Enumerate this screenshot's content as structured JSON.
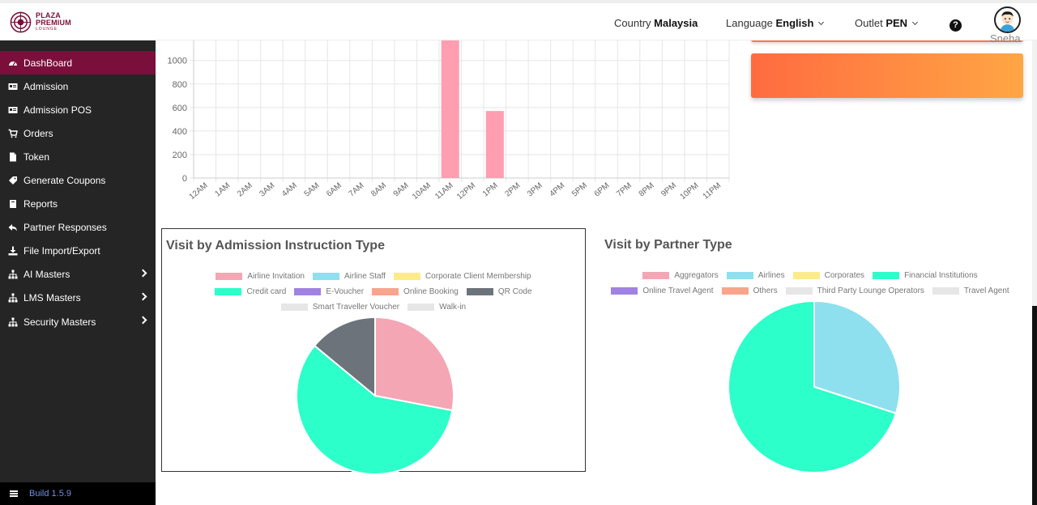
{
  "brand": {
    "name_line1": "PLAZA",
    "name_line2": "PREMIUM",
    "name_line3": "LOUNGE",
    "color": "#7b0f3c"
  },
  "header": {
    "country_label": "Country",
    "country_value": "Malaysia",
    "language_label": "Language",
    "language_value": "English",
    "outlet_label": "Outlet",
    "outlet_value": "PEN",
    "user_name": "Sneha"
  },
  "sidebar": {
    "items": [
      {
        "label": "DashBoard",
        "icon": "dashboard-icon",
        "active": true
      },
      {
        "label": "Admission",
        "icon": "id-card-icon"
      },
      {
        "label": "Admission POS",
        "icon": "pos-icon"
      },
      {
        "label": "Orders",
        "icon": "cart-icon"
      },
      {
        "label": "Token",
        "icon": "file-icon"
      },
      {
        "label": "Generate Coupons",
        "icon": "tag-icon"
      },
      {
        "label": "Reports",
        "icon": "book-icon"
      },
      {
        "label": "Partner Responses",
        "icon": "reply-icon"
      },
      {
        "label": "File Import/Export",
        "icon": "download-icon"
      },
      {
        "label": "AI Masters",
        "icon": "sitemap-icon",
        "submenu": true
      },
      {
        "label": "LMS Masters",
        "icon": "sitemap-icon",
        "submenu": true
      },
      {
        "label": "Security Masters",
        "icon": "sitemap-icon",
        "submenu": true
      }
    ],
    "build": "Build 1.5.9"
  },
  "chart_data": [
    {
      "type": "bar",
      "categories": [
        "12AM",
        "1AM",
        "2AM",
        "3AM",
        "4AM",
        "5AM",
        "6AM",
        "7AM",
        "8AM",
        "9AM",
        "10AM",
        "11AM",
        "12PM",
        "1PM",
        "2PM",
        "3PM",
        "4PM",
        "5PM",
        "6PM",
        "7PM",
        "8PM",
        "9PM",
        "10PM",
        "11PM"
      ],
      "values": [
        0,
        0,
        0,
        0,
        0,
        0,
        0,
        0,
        0,
        0,
        0,
        1170,
        0,
        570,
        0,
        0,
        0,
        0,
        0,
        0,
        0,
        0,
        0,
        0
      ],
      "yticks": [
        0,
        200,
        400,
        600,
        800,
        1000
      ],
      "ylim": [
        0,
        1170
      ],
      "color": "#ff9db1",
      "grid": true
    },
    {
      "type": "pie",
      "title": "Visit by Admission Instruction Type",
      "legend": [
        {
          "name": "Airline Invitation",
          "color": "#f4a6b4"
        },
        {
          "name": "Airline Staff",
          "color": "#8ee0ef"
        },
        {
          "name": "Corporate Client Membership",
          "color": "#fdeb8a"
        },
        {
          "name": "Credit card",
          "color": "#2cffc9"
        },
        {
          "name": "E-Voucher",
          "color": "#a082e2"
        },
        {
          "name": "Online Booking",
          "color": "#f8a58c"
        },
        {
          "name": "QR Code",
          "color": "#6d737b"
        },
        {
          "name": "Smart Traveller Voucher",
          "color": "#e6e6e6"
        },
        {
          "name": "Walk-in",
          "color": "#e6e6e6"
        }
      ],
      "slices": [
        {
          "name": "Airline Invitation",
          "value": 28,
          "color": "#f4a6b4"
        },
        {
          "name": "Credit card",
          "value": 58,
          "color": "#2cffc9"
        },
        {
          "name": "QR Code",
          "value": 14,
          "color": "#6d737b"
        }
      ]
    },
    {
      "type": "pie",
      "title": "Visit by Partner Type",
      "legend": [
        {
          "name": "Aggregators",
          "color": "#f4a6b4"
        },
        {
          "name": "Airlines",
          "color": "#8ee0ef"
        },
        {
          "name": "Corporates",
          "color": "#fdeb8a"
        },
        {
          "name": "Financial Institutions",
          "color": "#2cffc9"
        },
        {
          "name": "Online Travel Agent",
          "color": "#a082e2"
        },
        {
          "name": "Others",
          "color": "#f8a58c"
        },
        {
          "name": "Third Party Lounge Operators",
          "color": "#e6e6e6"
        },
        {
          "name": "Travel Agent",
          "color": "#e6e6e6"
        }
      ],
      "slices": [
        {
          "name": "Airlines",
          "value": 30,
          "color": "#8ee0ef"
        },
        {
          "name": "Financial Institutions",
          "value": 70,
          "color": "#2cffc9"
        }
      ]
    }
  ]
}
